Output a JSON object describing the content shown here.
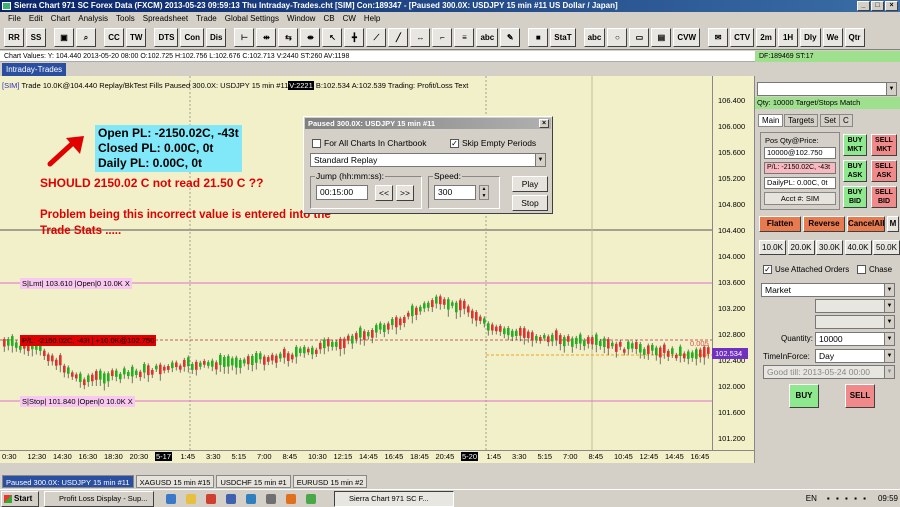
{
  "window": {
    "title": "Sierra Chart 971 SC Forex Data (FXCM)  2013-05-23  09:59:13 Thu   Intraday-Trades.cht [SIM] Con:189347 - [Paused 300.0X: USDJPY  15 min   #11  US Dollar / Japan]"
  },
  "menu": [
    "File",
    "Edit",
    "Chart",
    "Analysis",
    "Tools",
    "Spreadsheet",
    "Trade",
    "Global Settings",
    "Window",
    "CB",
    "CW",
    "Help"
  ],
  "toolbar": [
    "RR",
    "SS",
    "▣",
    "⌕",
    "CC",
    "TW",
    "DTS",
    "Con",
    "Dis",
    "⊢",
    "⇹",
    "⇆",
    "⇼",
    "↖",
    "╋",
    "⟋",
    "╱",
    "↔",
    "⌐",
    "≡",
    "abc",
    "✎",
    "■",
    "StaT",
    "abc",
    "○",
    "▭",
    "▤",
    "CVW",
    "✉",
    "CTV",
    "2m",
    "1H",
    "Dly",
    "We",
    "Qtr"
  ],
  "chart_values": "Chart Values: Y: 104.440  2013-05-20  08:00  O:102.725  H:102.756  L:102.676  C:102.713  V:2440  ST:260  AV:1198",
  "df_line": "DF:189469  ST:17",
  "chart_tab": "Intraday-Trades",
  "chart_info": {
    "sim": "[SIM]",
    "rest": " Trade  10.0K@104.440   Replay/BkTest Fills   Paused 300.0X: USDJPY  15 min   #11",
    "v": "V:2221",
    "tail": " B:102.534  A:102.539   Trading: Profit/Loss Text"
  },
  "price_axis": [
    "106.400",
    "106.000",
    "105.600",
    "105.200",
    "104.800",
    "104.400",
    "104.000",
    "103.600",
    "103.200",
    "102.800",
    "102.400",
    "102.000",
    "101.600",
    "101.200"
  ],
  "current_price": "102.534",
  "time_axis": [
    {
      "t": "0:30",
      "dark": false
    },
    {
      "t": "12:30",
      "dark": false
    },
    {
      "t": "14:30",
      "dark": false
    },
    {
      "t": "16:30",
      "dark": false
    },
    {
      "t": "18:30",
      "dark": false
    },
    {
      "t": "20:30",
      "dark": false
    },
    {
      "t": "5-17",
      "dark": true
    },
    {
      "t": "1:45",
      "dark": false
    },
    {
      "t": "3:30",
      "dark": false
    },
    {
      "t": "5:15",
      "dark": false
    },
    {
      "t": "7:00",
      "dark": false
    },
    {
      "t": "8:45",
      "dark": false
    },
    {
      "t": "10:30",
      "dark": false
    },
    {
      "t": "12:15",
      "dark": false
    },
    {
      "t": "14:45",
      "dark": false
    },
    {
      "t": "16:45",
      "dark": false
    },
    {
      "t": "18:45",
      "dark": false
    },
    {
      "t": "20:45",
      "dark": false
    },
    {
      "t": "5-20",
      "dark": true
    },
    {
      "t": "1:45",
      "dark": false
    },
    {
      "t": "3:30",
      "dark": false
    },
    {
      "t": "5:15",
      "dark": false
    },
    {
      "t": "7:00",
      "dark": false
    },
    {
      "t": "8:45",
      "dark": false
    },
    {
      "t": "10:45",
      "dark": false
    },
    {
      "t": "12:45",
      "dark": false
    },
    {
      "t": "14:45",
      "dark": false
    },
    {
      "t": "16:45",
      "dark": false
    }
  ],
  "orders": {
    "limit": "S|Lmt| 103.610 |Open|0  10.0K  X",
    "position": "P/L: -2150.02C, -43t | +10.0K@102.750",
    "stop": "S|Stop| 101.840 |Open|0  10.0K  X",
    "pl_small": "0.005"
  },
  "annotation": {
    "open_pl": "Open PL: -2150.02C, -43t",
    "closed_pl": "Closed PL: 0.00C, 0t",
    "daily_pl": "Daily PL: 0.00C, 0t",
    "note1": "SHOULD 2150.02 C not read 21.50 C ??",
    "note2": "Problem being this incorrect value is entered into the Trade Stats ....."
  },
  "dialog": {
    "title": "Paused 300.0X: USDJPY  15 min  #11",
    "all_charts": "For All Charts In Chartbook",
    "skip_empty": "Skip Empty Periods",
    "replay_mode": "Standard Replay",
    "jump_label": "Jump (hh:mm:ss):",
    "jump_value": "00:15:00",
    "back": "<<",
    "fwd": ">>",
    "speed_label": "Speed:",
    "speed_value": "300",
    "play": "Play",
    "stop": "Stop"
  },
  "trade_panel": {
    "header": "Qty: 10000 Target/Stops Match",
    "tabs": [
      "Main",
      "Targets",
      "Set",
      "C"
    ],
    "pos_label": "Pos Qty@Price:",
    "pos_value": "10000@102.750",
    "pl_value": "P/L: -2150.02C, -43t",
    "daily_value": "DailyPL: 0.00C, 0t",
    "acct": "Acct #: SIM",
    "buy_mkt": "BUY MKT",
    "sell_mkt": "SELL MKT",
    "buy_ask": "BUY ASK",
    "sell_ask": "SELL ASK",
    "buy_bid": "BUY BID",
    "sell_bid": "SELL BID",
    "flatten": "Flatten",
    "reverse": "Reverse",
    "cancel_all": "CancelAll",
    "m": "M",
    "qty_buttons": [
      "10.0K",
      "20.0K",
      "30.0K",
      "40.0K",
      "50.0K"
    ],
    "use_attached": "Use Attached Orders",
    "chase": "Chase",
    "order_type": "Market",
    "quantity_label": "Quantity:",
    "quantity_value": "10000",
    "tif_label": "TimeInForce:",
    "tif_value": "Day",
    "good_till": "Good till: 2013-05-24 00:00",
    "buy": "BUY",
    "sell": "SELL"
  },
  "chart_tabs": [
    {
      "label": "Paused 300.0X: USDJPY  15 min  #11",
      "active": true
    },
    {
      "label": "XAGUSD  15 min  #15",
      "active": false
    },
    {
      "label": "USDCHF  15 min  #1",
      "active": false
    },
    {
      "label": "EURUSD  15 min  #2",
      "active": false
    }
  ],
  "taskbar": {
    "start": "Start",
    "tasks": [
      "Profit Loss Display - Sup...",
      "Sierra Chart 971 SC F..."
    ],
    "lang": "EN",
    "clock": "09:59"
  }
}
